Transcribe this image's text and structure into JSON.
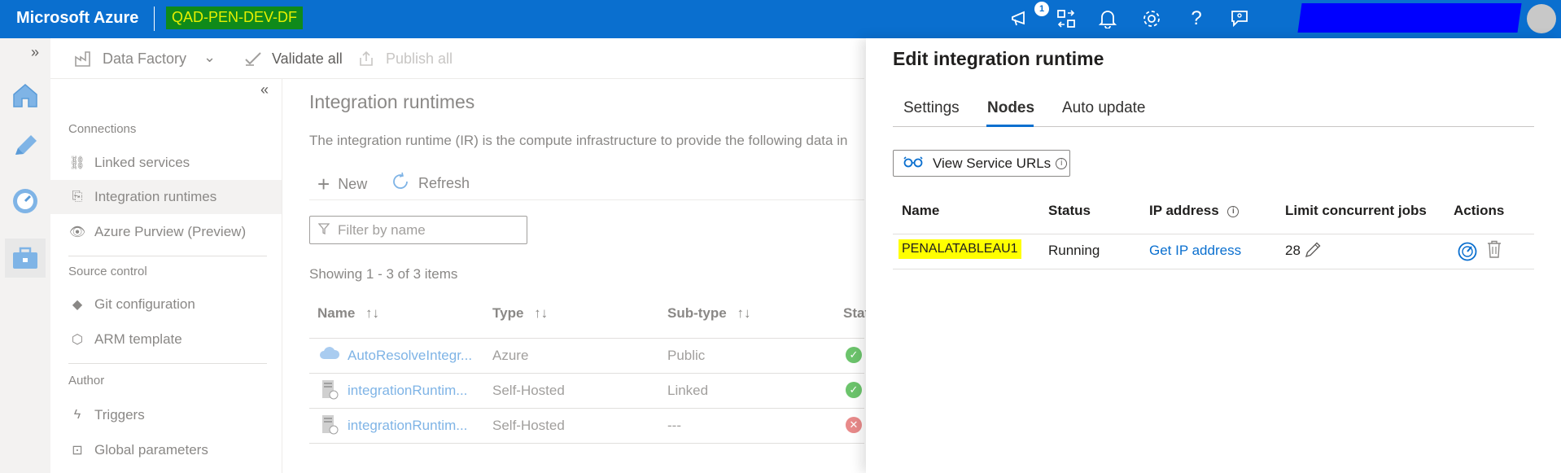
{
  "topbar": {
    "brand": "Microsoft Azure",
    "factory_name": "QAD-PEN-DEV-DF",
    "notification_count": "1"
  },
  "toolbar": {
    "factory_label": "Data Factory",
    "validate_all": "Validate all",
    "publish_all": "Publish all"
  },
  "nav": {
    "sections": [
      {
        "title": "Connections",
        "items": [
          "Linked services",
          "Integration runtimes",
          "Azure Purview (Preview)"
        ]
      },
      {
        "title": "Source control",
        "items": [
          "Git configuration",
          "ARM template"
        ]
      },
      {
        "title": "Author",
        "items": [
          "Triggers",
          "Global parameters"
        ]
      }
    ],
    "selected": "Integration runtimes"
  },
  "main": {
    "title": "Integration runtimes",
    "description": "The integration runtime (IR) is the compute infrastructure to provide the following data in",
    "new_label": "New",
    "refresh_label": "Refresh",
    "filter_placeholder": "Filter by name",
    "showing": "Showing 1 - 3 of 3 items",
    "columns": [
      "Name",
      "Type",
      "Sub-type",
      "Stat"
    ],
    "rows": [
      {
        "name": "AutoResolveIntegr...",
        "type": "Azure",
        "subtype": "Public",
        "status": "ok"
      },
      {
        "name": "integrationRuntim...",
        "type": "Self-Hosted",
        "subtype": "Linked",
        "status": "ok"
      },
      {
        "name": "integrationRuntim...",
        "type": "Self-Hosted",
        "subtype": "---",
        "status": "error"
      }
    ]
  },
  "panel": {
    "title": "Edit integration runtime",
    "tabs": [
      "Settings",
      "Nodes",
      "Auto update"
    ],
    "selected_tab": "Nodes",
    "view_urls_label": "View Service URLs",
    "columns": [
      "Name",
      "Status",
      "IP address",
      "Limit concurrent jobs",
      "Actions"
    ],
    "node": {
      "name": "PENALATABLEAU1",
      "status": "Running",
      "ip_link": "Get IP address",
      "limit": "28"
    }
  }
}
